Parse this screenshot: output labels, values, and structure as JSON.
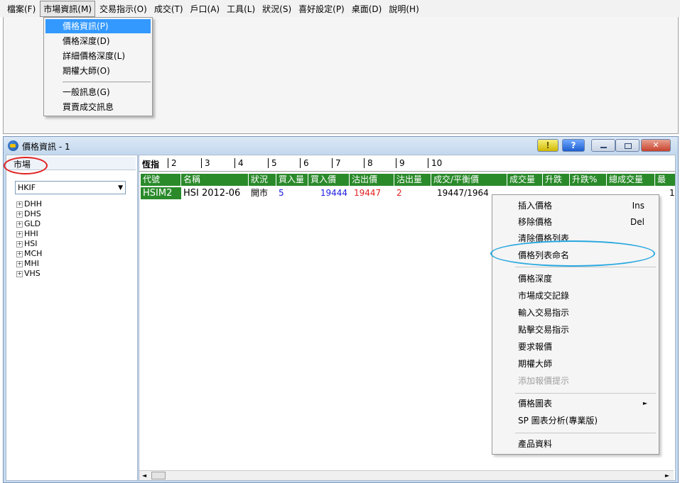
{
  "menubar": {
    "items": [
      "檔案(F)",
      "市場資訊(M)",
      "交易指示(O)",
      "成交(T)",
      "戶口(A)",
      "工具(L)",
      "狀況(S)",
      "喜好設定(P)",
      "桌面(D)",
      "說明(H)"
    ]
  },
  "market_menu": {
    "items": [
      "價格資訊(P)",
      "價格深度(D)",
      "詳細價格深度(L)",
      "期權大師(O)",
      "一般訊息(G)",
      "買賣成交訊息"
    ]
  },
  "window": {
    "title": "價格資訊 - 1",
    "yellow_button": "!",
    "help_button": "?"
  },
  "left_panel": {
    "header": "市場",
    "market_value": "HKIF",
    "tree": [
      "DHH",
      "DHS",
      "GLD",
      "HHI",
      "HSI",
      "MCH",
      "MHI",
      "VHS"
    ],
    "expander": "+"
  },
  "tabs": [
    "恆指",
    "2",
    "3",
    "4",
    "5",
    "6",
    "7",
    "8",
    "9",
    "10"
  ],
  "grid": {
    "columns": [
      "代號",
      "名稱",
      "狀況",
      "買入量",
      "買入價",
      "沽出價",
      "沽出量",
      "成交/平衡價",
      "成交量",
      "升跌",
      "升跌%",
      "總成交量",
      "最"
    ],
    "row": {
      "code": "HSIM2",
      "name": "HSI 2012-06",
      "status": "開市",
      "bid_qty": "5",
      "bid": "19444",
      "ask": "19447",
      "ask_qty": "2",
      "last": "19447/1964",
      "overflow": "1"
    },
    "colors": {
      "header_bg": "#2a8a2a",
      "bid": "#1a1ae0",
      "ask": "#e02020"
    }
  },
  "context_menu": {
    "items": [
      {
        "label": "插入價格",
        "shortcut": "Ins"
      },
      {
        "label": "移除價格",
        "shortcut": "Del"
      },
      {
        "label": "清除價格列表"
      },
      {
        "label": "價格列表命名"
      },
      {
        "label": "價格深度"
      },
      {
        "label": "市場成交記錄"
      },
      {
        "label": "輸入交易指示"
      },
      {
        "label": "點擊交易指示"
      },
      {
        "label": "要求報價"
      },
      {
        "label": "期權大師"
      },
      {
        "label": "添加報價提示"
      },
      {
        "label": "價格圖表"
      },
      {
        "label": "SP 圖表分析(專業版)"
      },
      {
        "label": "產品資料"
      }
    ],
    "submenu_arrow": "►"
  },
  "annotation_colors": {
    "red": "#e02020",
    "blue": "#29a8e0"
  }
}
